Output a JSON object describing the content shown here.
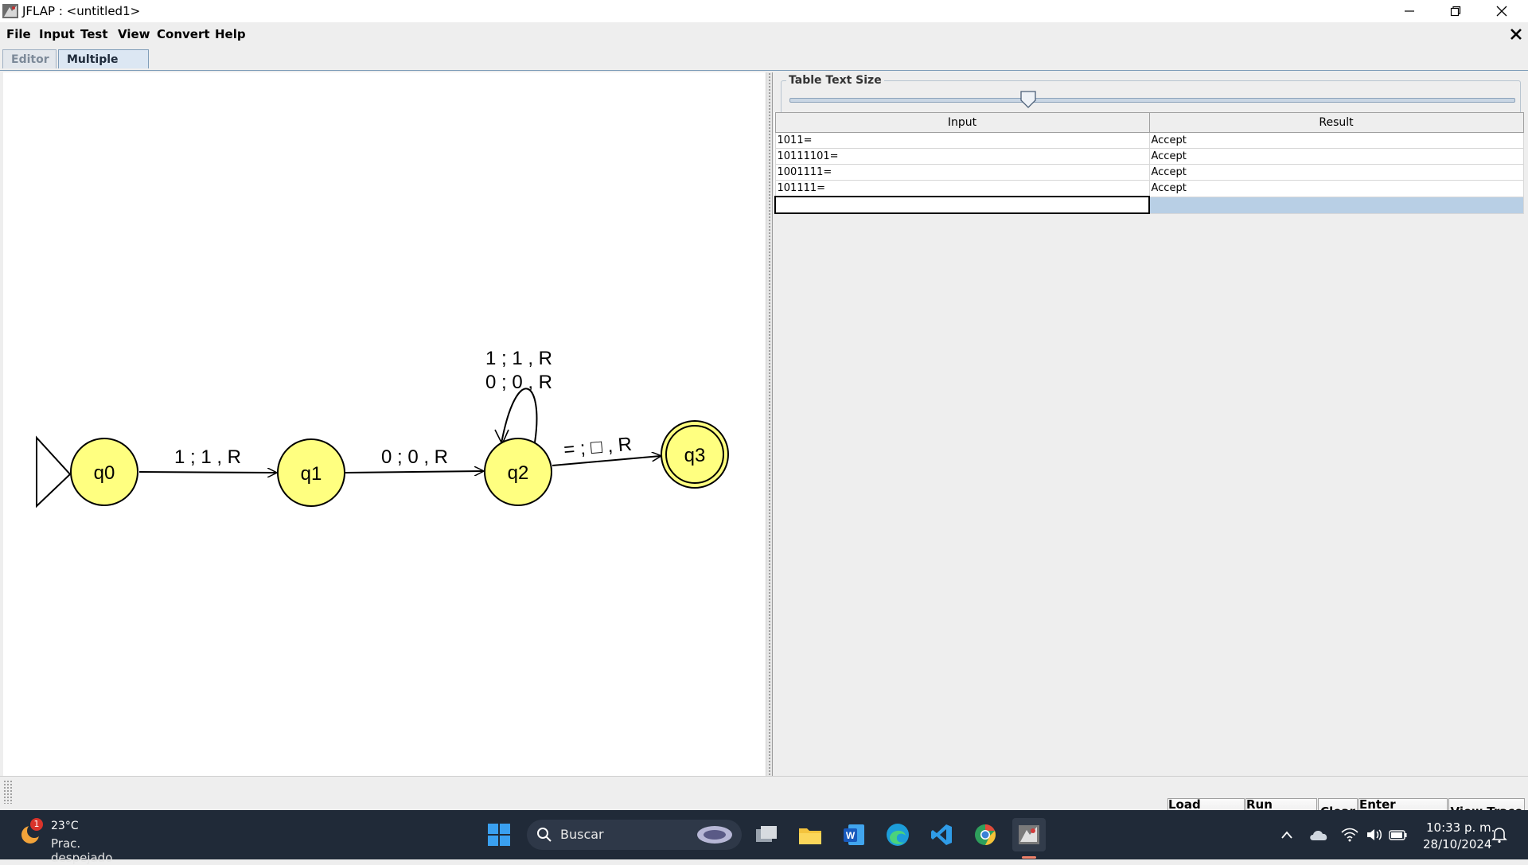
{
  "window": {
    "title": "JFLAP : <untitled1>"
  },
  "menu": [
    "File",
    "Input",
    "Test",
    "View",
    "Convert",
    "Help"
  ],
  "tabs": [
    {
      "label": "Editor",
      "active": false
    },
    {
      "label": "Multiple Run",
      "active": true
    }
  ],
  "automaton": {
    "states": [
      {
        "id": "q0",
        "initial": true,
        "final": false
      },
      {
        "id": "q1",
        "initial": false,
        "final": false
      },
      {
        "id": "q2",
        "initial": false,
        "final": false
      },
      {
        "id": "q3",
        "initial": false,
        "final": true
      }
    ],
    "transitions": [
      {
        "from": "q0",
        "to": "q1",
        "label": "1 ; 1 , R"
      },
      {
        "from": "q1",
        "to": "q2",
        "label": "0 ; 0 , R"
      },
      {
        "from": "q2",
        "to": "q2",
        "labels": [
          "1 ; 1 , R",
          "0 ; 0 , R"
        ]
      },
      {
        "from": "q2",
        "to": "q3",
        "label": "= ; □ , R"
      }
    ]
  },
  "panel": {
    "slider_title": "Table Text Size",
    "slider_level": 0.33,
    "columns": [
      "Input",
      "Result"
    ],
    "rows": [
      {
        "input": "1011=",
        "result": "Accept"
      },
      {
        "input": "10111101=",
        "result": "Accept"
      },
      {
        "input": "1001111=",
        "result": "Accept"
      },
      {
        "input": "101111=",
        "result": "Accept"
      }
    ]
  },
  "buttons": [
    "Load Inputs",
    "Run Inputs",
    "Clear",
    "Enter Lambda",
    "View Trace"
  ],
  "taskbar": {
    "weather_badge": "1",
    "weather_temp": "23°C",
    "weather_desc": "Prac. despejado",
    "search_placeholder": "Buscar",
    "time": "10:33 p. m.",
    "date": "28/10/2024"
  },
  "colors": {
    "state_fill": "#ffff80",
    "accent": "#b8cfe5",
    "taskbar_bg": "#202a38"
  }
}
